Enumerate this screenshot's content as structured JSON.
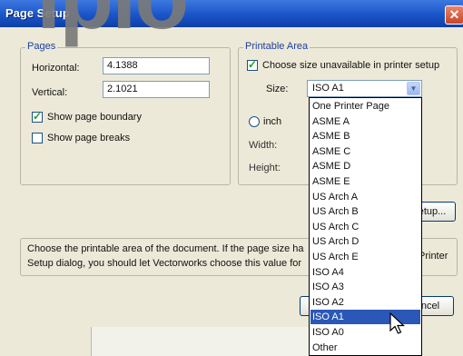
{
  "watermark": "ipio",
  "window": {
    "title": "Page Setup",
    "close_glyph": "✕"
  },
  "pages": {
    "group_label": "Pages",
    "horizontal_label": "Horizontal:",
    "horizontal_value": "4.1388",
    "vertical_label": "Vertical:",
    "vertical_value": "2.1021",
    "show_boundary_label": "Show page boundary",
    "show_boundary_checked": true,
    "show_breaks_label": "Show page breaks",
    "show_breaks_checked": false
  },
  "printable": {
    "group_label": "Printable Area",
    "choose_size_label": "Choose size unavailable in printer setup",
    "choose_size_checked": true,
    "size_label": "Size:",
    "size_value": "ISO A1",
    "inch_label": "inch",
    "width_label": "Width:",
    "height_label": "Height:"
  },
  "setup_button_label": "etup...",
  "help_text_line1": "Choose the printable area of the document. If the page size ha",
  "help_text_line2": "Setup dialog, you should let Vectorworks choose this value for",
  "help_text_right": "Printer",
  "cancel_button_label": "ncel",
  "dropdown": {
    "options": [
      "One Printer Page",
      "ASME A",
      "ASME B",
      "ASME C",
      "ASME D",
      "ASME E",
      "US Arch A",
      "US Arch B",
      "US Arch C",
      "US Arch D",
      "US Arch E",
      "ISO A4",
      "ISO A3",
      "ISO A2",
      "ISO A1",
      "ISO A0",
      "Other"
    ],
    "selected": "ISO A1"
  },
  "colors": {
    "title_bar": "#1a55c8",
    "selection": "#2b58b7",
    "group_label": "#1c3fa0"
  },
  "icons": {
    "close": "close-icon",
    "dropdown_arrow": "chevron-down-icon",
    "cursor": "pointer-cursor-icon"
  }
}
